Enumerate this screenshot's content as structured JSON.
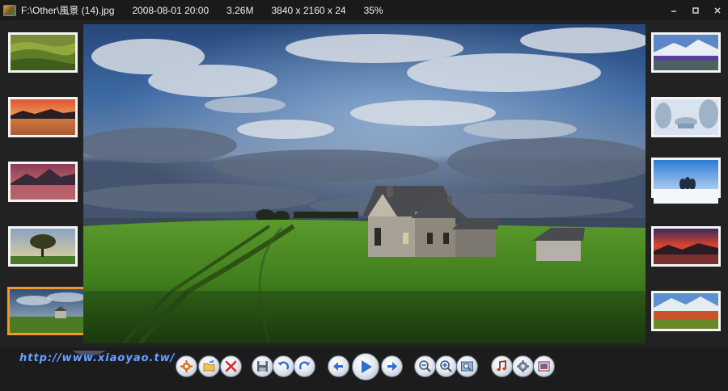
{
  "titlebar": {
    "path": "F:\\Other\\風景 (14).jpg",
    "date": "2008-08-01 20:00",
    "size": "3.26M",
    "resolution": "3840 x 2160 x 24",
    "zoom": "35%"
  },
  "window_controls": {
    "minimize": "–",
    "maximize": "□",
    "close": "✕"
  },
  "watermark": {
    "url": "http://www.xiaoyao.tw/"
  },
  "toolbar_icons": [
    "settings-gear-icon",
    "open-folder-icon",
    "delete-icon",
    "save-icon",
    "rotate-left-icon",
    "rotate-right-icon",
    "previous-icon",
    "play-slideshow-icon",
    "next-icon",
    "zoom-out-icon",
    "zoom-in-icon",
    "fit-to-window-icon",
    "music-icon",
    "options-icon",
    "fullscreen-icon"
  ],
  "colors": {
    "active_thumb_border": "#f19a2a",
    "thumb_border": "#f4f4f4",
    "button_accent": "#2d6fd6"
  }
}
